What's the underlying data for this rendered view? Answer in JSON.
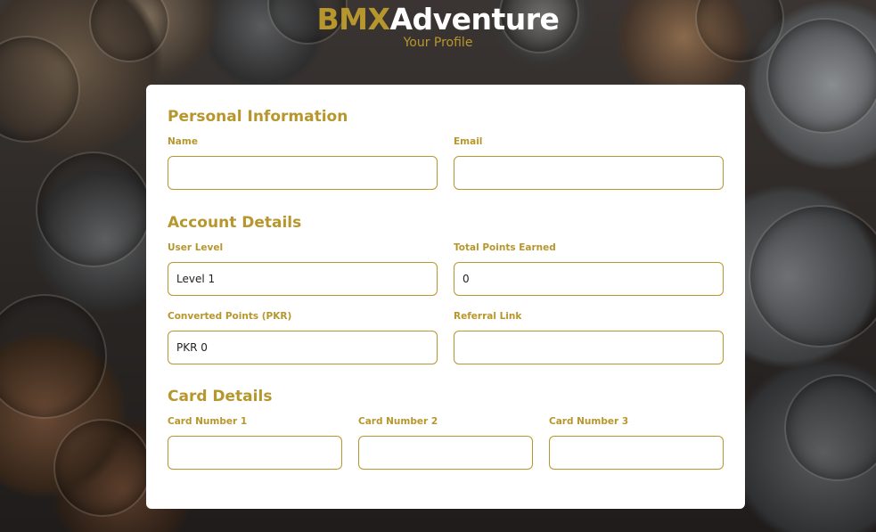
{
  "header": {
    "brand_accent": "BMX",
    "brand_rest": "Adventure",
    "subtitle": "Your Profile"
  },
  "colors": {
    "accent": "#b7972d",
    "card_bg": "#ffffff",
    "brand_white": "#ffffff"
  },
  "personal": {
    "title": "Personal Information",
    "name_label": "Name",
    "name_value": "",
    "email_label": "Email",
    "email_value": ""
  },
  "account": {
    "title": "Account Details",
    "level_label": "User Level",
    "level_value": "Level 1",
    "points_label": "Total Points Earned",
    "points_value": "0",
    "converted_label": "Converted Points (PKR)",
    "converted_value": "PKR 0",
    "referral_label": "Referral Link",
    "referral_value": ""
  },
  "cards": {
    "title": "Card Details",
    "card1_label": "Card Number 1",
    "card1_value": "",
    "card2_label": "Card Number 2",
    "card2_value": "",
    "card3_label": "Card Number 3",
    "card3_value": ""
  }
}
